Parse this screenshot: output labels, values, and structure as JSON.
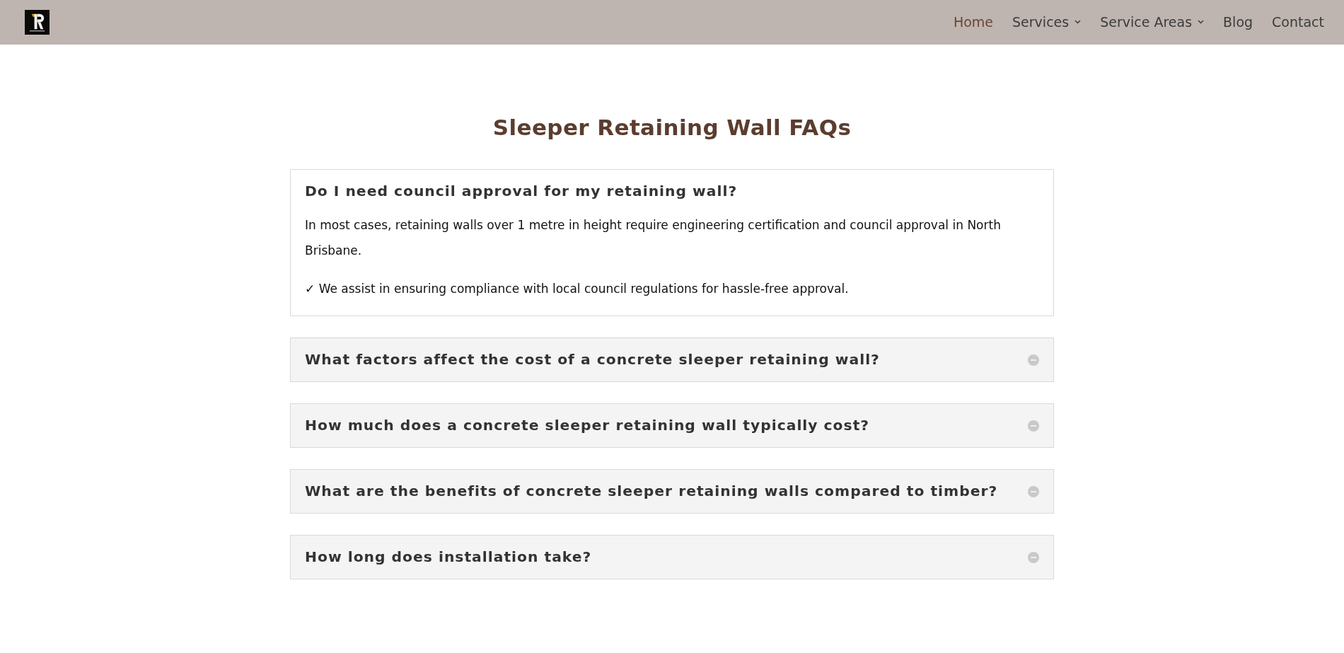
{
  "header": {
    "nav": [
      {
        "label": "Home",
        "selected": true,
        "dropdown": false
      },
      {
        "label": "Services",
        "selected": false,
        "dropdown": true
      },
      {
        "label": "Service Areas",
        "selected": false,
        "dropdown": true
      },
      {
        "label": "Blog",
        "selected": false,
        "dropdown": false
      },
      {
        "label": "Contact",
        "selected": false,
        "dropdown": false
      }
    ]
  },
  "faq": {
    "title": "Sleeper Retaining Wall FAQs",
    "items": [
      {
        "question": "Do I need council approval for my retaining wall?",
        "expanded": true,
        "answer": [
          "In most cases, retaining walls over 1 metre in height require engineering certification and council approval in North Brisbane.",
          "✓ We assist in ensuring compliance with local council regulations for hassle-free approval."
        ]
      },
      {
        "question": "What factors affect the cost of a concrete sleeper retaining wall?",
        "expanded": false
      },
      {
        "question": "How much does a concrete sleeper retaining wall typically cost?",
        "expanded": false
      },
      {
        "question": "What are the benefits of concrete sleeper retaining walls compared to timber?",
        "expanded": false
      },
      {
        "question": "How long does installation take?",
        "expanded": false
      }
    ]
  }
}
